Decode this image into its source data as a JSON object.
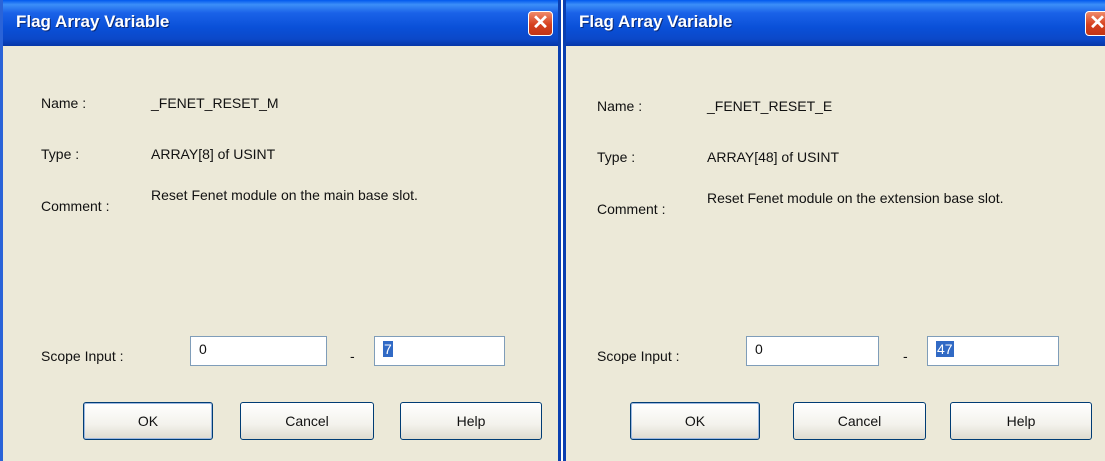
{
  "dialogs": [
    {
      "title": "Flag Array Variable",
      "name_label": "Name :",
      "name_value": "_FENET_RESET_M",
      "type_label": "Type :",
      "type_value": "ARRAY[8] of USINT",
      "comment_label": "Comment :",
      "comment_value": "Reset Fenet module on the main base slot.",
      "scope_label": "Scope Input :",
      "scope_from": "0",
      "scope_separator": "-",
      "scope_to": "7",
      "ok_label": "OK",
      "cancel_label": "Cancel",
      "help_label": "Help",
      "close_glyph": "✕"
    },
    {
      "title": "Flag Array Variable",
      "name_label": "Name :",
      "name_value": "_FENET_RESET_E",
      "type_label": "Type :",
      "type_value": "ARRAY[48] of USINT",
      "comment_label": "Comment :",
      "comment_value": "Reset Fenet module on the extension base slot.",
      "scope_label": "Scope Input :",
      "scope_from": "0",
      "scope_separator": "-",
      "scope_to": "47",
      "ok_label": "OK",
      "cancel_label": "Cancel",
      "help_label": "Help",
      "close_glyph": "✕"
    }
  ],
  "colors": {
    "titlebar": "#0a50d8",
    "dialog_bg": "#ece9d8",
    "close_button": "#d6401e",
    "selection": "#316ac5"
  },
  "icons": [
    "close-icon"
  ]
}
